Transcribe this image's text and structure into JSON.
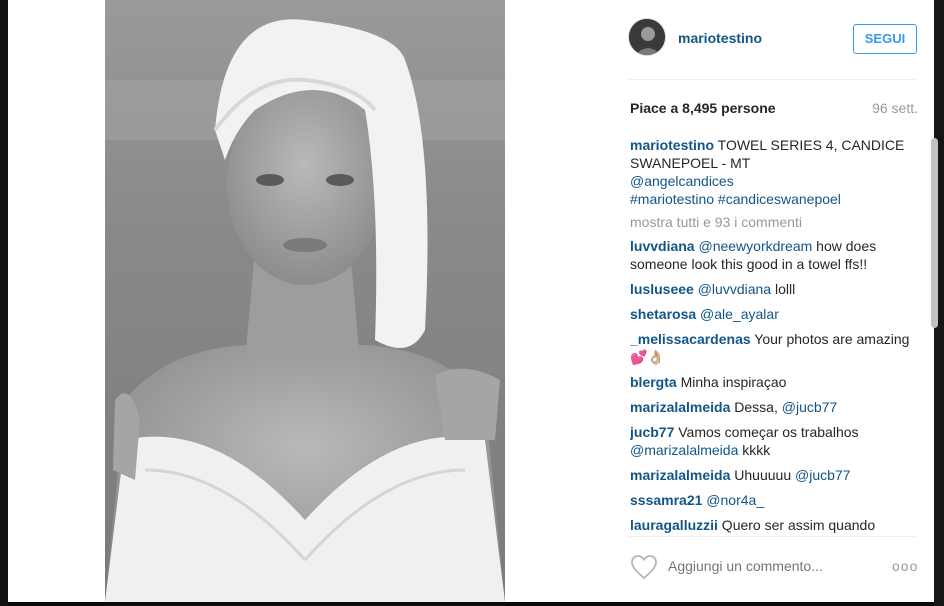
{
  "post": {
    "username": "mariotestino",
    "follow_label": "SEGUI",
    "likes": "Piace a 8,495 persone",
    "time": "96 sett."
  },
  "caption": {
    "user": "mariotestino",
    "text": " TOWEL SERIES 4, CANDICE SWANEPOEL - MT",
    "mention": "@angelcandices",
    "hashtags": "#mariotestino #candiceswanepoel"
  },
  "show_more": "mostra tutti e 93 i commenti",
  "comments": [
    {
      "user": "luvvdiana",
      "mention": "@neewyorkdream",
      "text": " how does someone look this good in a towel ffs!!"
    },
    {
      "user": "lusluseee",
      "mention": "@luvvdiana",
      "text": " lolll"
    },
    {
      "user": "shetarosa",
      "mention": "@ale_ayalar",
      "text": ""
    },
    {
      "user": "_melissacardenas",
      "mention": "",
      "text": " Your photos are amazing 💕👌🏼"
    },
    {
      "user": "blergta",
      "mention": "",
      "text": " Minha inspiraçao"
    },
    {
      "user": "marizalalmeida",
      "mention": "",
      "text": " Dessa, ",
      "mention_after": "@jucb77"
    },
    {
      "user": "jucb77",
      "mention": "",
      "text": " Vamos começar os trabalhos ",
      "mention_after": "@marizalalmeida",
      "text_after": " kkkk"
    },
    {
      "user": "marizalalmeida",
      "mention": "",
      "text": " Uhuuuuu ",
      "mention_after": "@jucb77"
    },
    {
      "user": "sssamra21",
      "mention": "@nor4a_",
      "text": ""
    },
    {
      "user": "lauragalluzzii",
      "mention": "",
      "text": " Quero ser assim quando"
    }
  ],
  "footer": {
    "comment_placeholder": "Aggiungi un commento...",
    "options_label": "ooo"
  },
  "icons": {
    "like": "heart-icon",
    "options": "more-options-icon"
  },
  "colors": {
    "link": "#125688",
    "follow": "#3897f0",
    "muted": "#999999"
  }
}
